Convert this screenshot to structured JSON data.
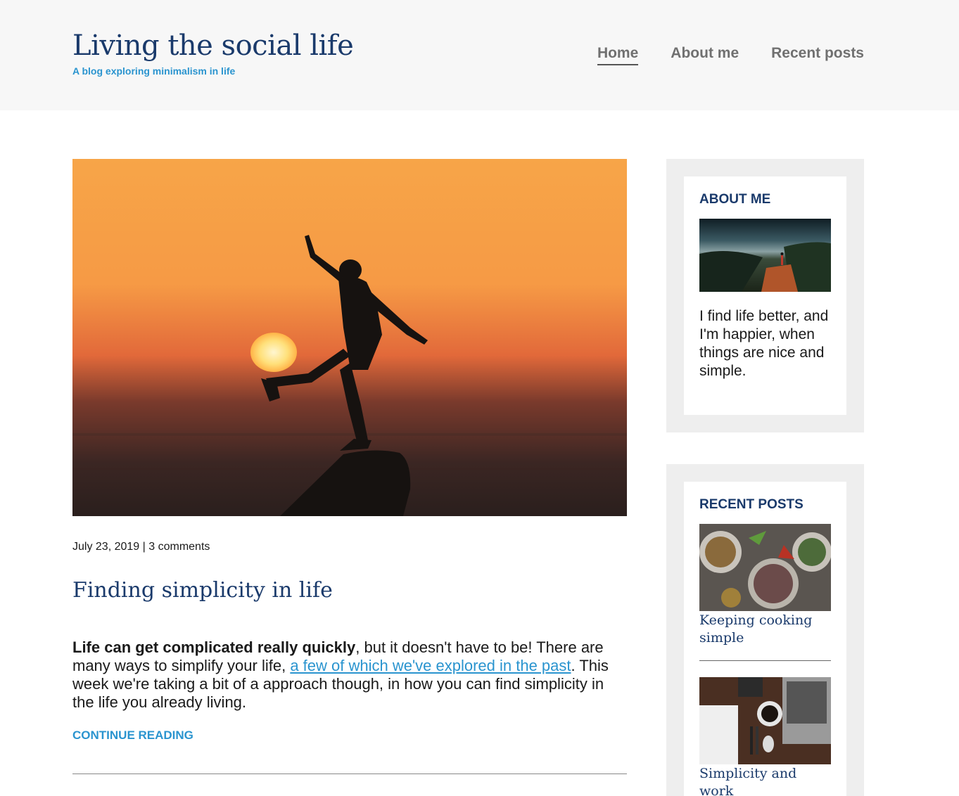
{
  "header": {
    "title": "Living the social life",
    "subtitle": "A blog exploring minimalism in life"
  },
  "nav": {
    "items": [
      {
        "label": "Home",
        "active": true
      },
      {
        "label": "About me",
        "active": false
      },
      {
        "label": "Recent posts",
        "active": false
      }
    ]
  },
  "post": {
    "image": "sunset-silhouette-image",
    "date": "July 23, 2019",
    "separator": "|",
    "comments": "3 comments",
    "title": "Finding simplicity in life",
    "body_bold": "Life can get complicated really quickly",
    "body_part1": ", but it doesn't have to be! There are many ways to simplify your life, ",
    "body_link": "a few of which we've explored in the past",
    "body_part2": ". This week we're taking a bit of a approach though, in how you can find simplicity in the life you already living.",
    "continue_label": "Continue reading"
  },
  "sidebar": {
    "about": {
      "heading": "About me",
      "image": "hiker-landscape-image",
      "text": "I find life better, and I'm happier, when things are nice and simple."
    },
    "recent": {
      "heading": "Recent posts",
      "items": [
        {
          "title": "Keeping cooking simple",
          "image": "food-bowls-image"
        },
        {
          "title": "Simplicity and work",
          "image": "desk-workspace-image"
        }
      ]
    }
  },
  "colors": {
    "brand_navy": "#1a3a6b",
    "accent_blue": "#2a94cf",
    "nav_gray": "#707070",
    "header_bg": "#f7f7f7",
    "widget_bg": "#eeeeee"
  }
}
